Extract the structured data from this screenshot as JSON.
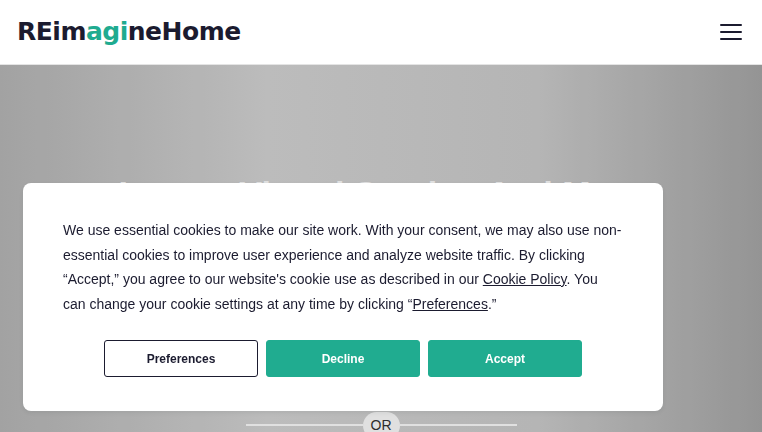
{
  "header": {
    "logo_parts": [
      {
        "text": "REim",
        "color": "#1b1b2f"
      },
      {
        "text": "agi",
        "color": "#1fab90"
      },
      {
        "text": "neHome",
        "color": "#1b1b2f"
      }
    ]
  },
  "hero": {
    "title": "Instant Virtual Staging And More",
    "divider": "OR"
  },
  "cookie": {
    "text_before": "We use essential cookies to make our site work. With your consent, we may also use non-essential cookies to improve user experience and analyze website traffic. By clicking “Accept,” you agree to our website's cookie use as described in our ",
    "policy_link": "Cookie Policy",
    "text_middle": ". You can change your cookie settings at any time by clicking “",
    "preferences_link": "Preferences",
    "text_after": ".”",
    "buttons": [
      {
        "label": "Preferences",
        "kind": "outline"
      },
      {
        "label": "Decline",
        "kind": "fill"
      },
      {
        "label": "Accept",
        "kind": "fill"
      }
    ]
  }
}
